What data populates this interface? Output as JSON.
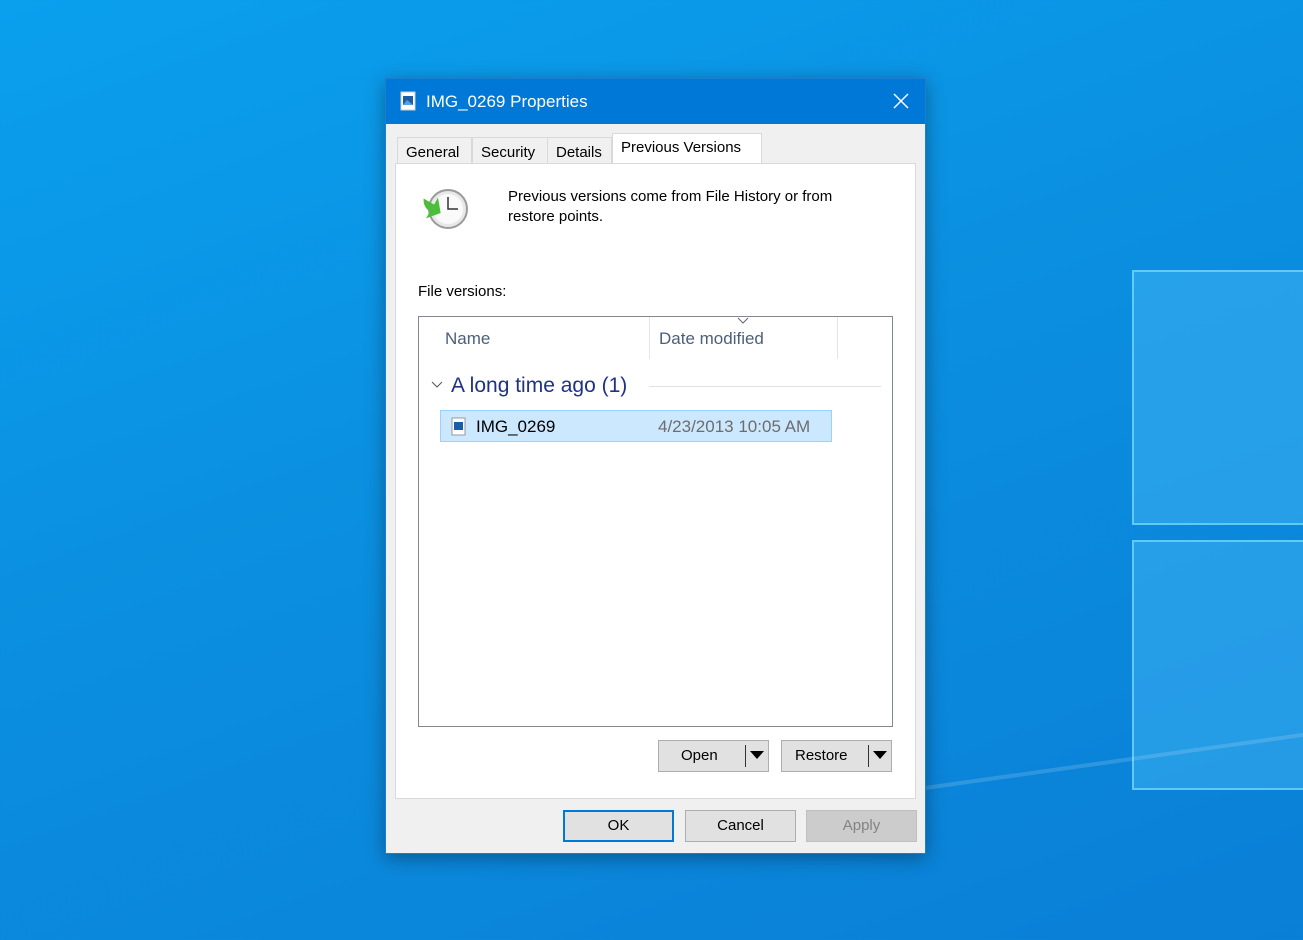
{
  "window": {
    "title": "IMG_0269 Properties",
    "close_icon": "close-icon",
    "file_icon": "image-file-icon",
    "accent": "#0078d7"
  },
  "tabs": [
    {
      "label": "General"
    },
    {
      "label": "Security"
    },
    {
      "label": "Details"
    },
    {
      "label": "Previous Versions",
      "active": true
    }
  ],
  "info": {
    "icon": "restore-clock-icon",
    "text_line1": "Previous versions come from File History or from",
    "text_line2": "restore points."
  },
  "file_versions": {
    "label": "File versions:",
    "columns": [
      {
        "label": "Name"
      },
      {
        "label": "Date modified",
        "sorted": "descending"
      }
    ],
    "groups": [
      {
        "label": "A long time ago (1)",
        "expanded": true,
        "items": [
          {
            "name": "IMG_0269",
            "date_modified": "4/23/2013 10:05 AM",
            "selected": true
          }
        ]
      }
    ]
  },
  "actions": {
    "open": "Open",
    "restore": "Restore"
  },
  "footer": {
    "ok": "OK",
    "cancel": "Cancel",
    "apply": "Apply",
    "apply_disabled": true
  }
}
